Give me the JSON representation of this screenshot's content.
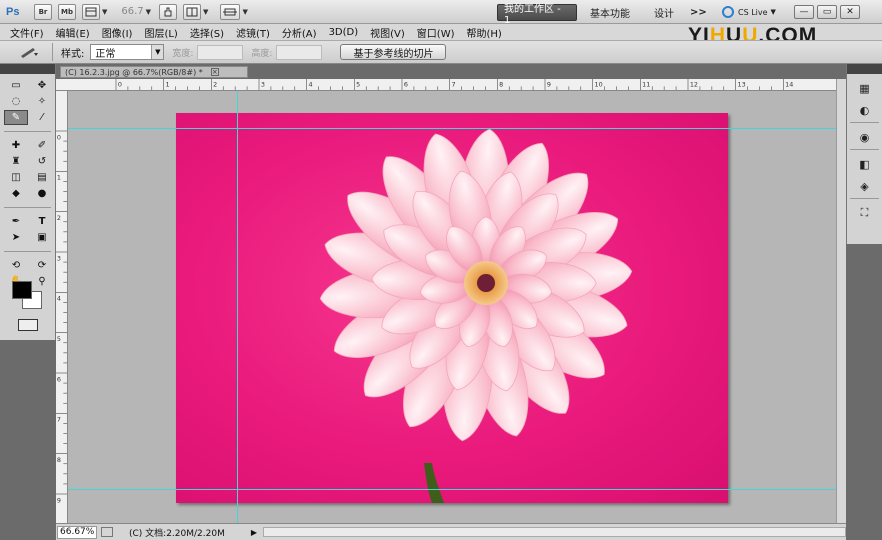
{
  "app": {
    "logo": "Ps",
    "bridge_label": "Br",
    "minibridge_label": "Mb",
    "zoom": "66.7"
  },
  "workspaces": {
    "active": "我的工作区 - 1",
    "basic": "基本功能",
    "design": "设计",
    "more": ">>"
  },
  "cslive": {
    "label": "CS Live"
  },
  "window_controls": {
    "minimize": "—",
    "restore": "▭",
    "close": "✕"
  },
  "menu": [
    "文件(F)",
    "编辑(E)",
    "图像(I)",
    "图层(L)",
    "选择(S)",
    "滤镜(T)",
    "分析(A)",
    "3D(D)",
    "视图(V)",
    "窗口(W)",
    "帮助(H)"
  ],
  "watermark": {
    "prefix": "YI",
    "highlight": "H",
    "middle": "U",
    "highlight2": "U",
    "suffix": ".COM"
  },
  "options": {
    "style_label": "样式:",
    "style_value": "正常",
    "width_label": "宽度:",
    "height_label": "高度:",
    "slice_button": "基于参考线的切片"
  },
  "document": {
    "tab_title": "(C) 16.2.3.jpg @ 66.7%(RGB/8#) *",
    "close": "×",
    "ruler_h": [
      "0",
      "1",
      "2",
      "3",
      "4",
      "5",
      "6",
      "7",
      "8",
      "9",
      "10",
      "11",
      "12",
      "13",
      "14"
    ],
    "ruler_v": [
      "0",
      "1",
      "2",
      "3",
      "4",
      "5",
      "6",
      "7",
      "8",
      "9"
    ]
  },
  "status": {
    "zoom": "66.67%",
    "doc_info": "(C) 文档:2.20M/2.20M",
    "arrow": "▶"
  },
  "colors": {
    "photo_bg": "#e91a7c",
    "guide": "#43d6d6",
    "foreground": "#000000",
    "background": "#ffffff"
  }
}
